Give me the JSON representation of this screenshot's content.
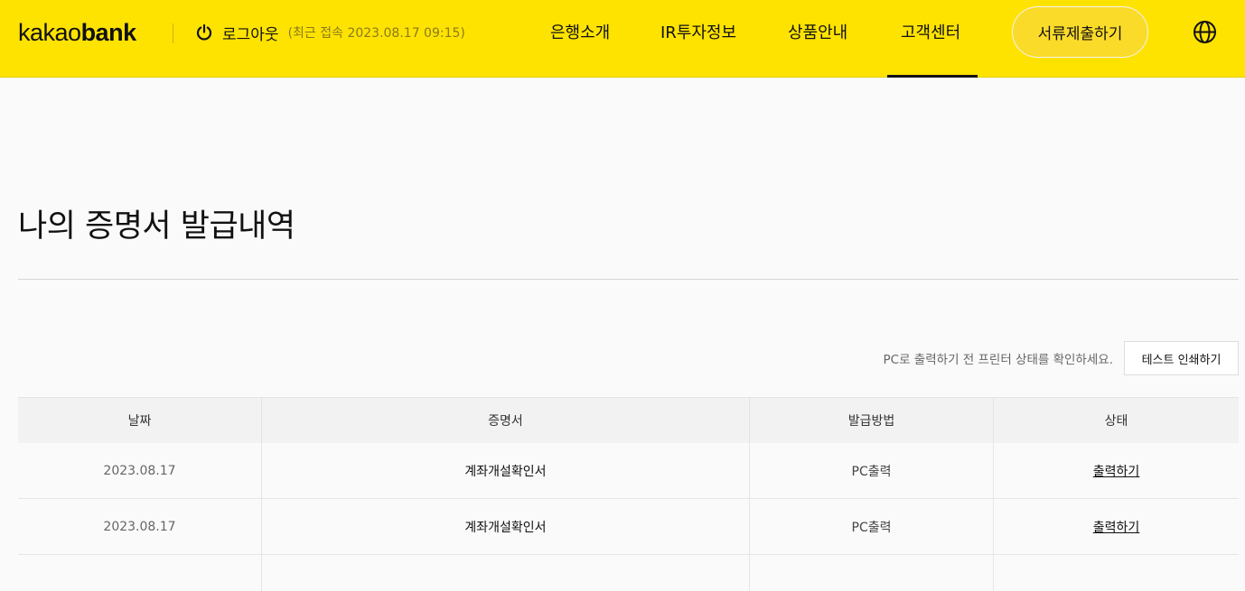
{
  "header": {
    "logo_light": "kakao",
    "logo_bold": "bank",
    "logout_label": "로그아웃",
    "last_access": "(최근 접속 2023.08.17 09:15)",
    "nav": [
      "은행소개",
      "IR투자정보",
      "상품안내",
      "고객센터"
    ],
    "active_nav": "고객센터",
    "submit_button": "서류제출하기",
    "globe_icon": "globe-icon"
  },
  "main": {
    "title": "나의 증명서 발급내역",
    "printer_note": "PC로 출력하기 전 프린터 상태를 확인하세요.",
    "test_print_button": "테스트 인쇄하기"
  },
  "table": {
    "headers": [
      "날짜",
      "증명서",
      "발급방법",
      "상태"
    ],
    "rows": [
      {
        "date": "2023.08.17",
        "certificate": "계좌개설확인서",
        "method": "PC출력",
        "status": "출력하기"
      },
      {
        "date": "2023.08.17",
        "certificate": "계좌개설확인서",
        "method": "PC출력",
        "status": "출력하기"
      }
    ]
  },
  "colors": {
    "header_bg": "#ffe300",
    "button_bg": "#fbdb2a",
    "page_bg": "#fafafa"
  }
}
